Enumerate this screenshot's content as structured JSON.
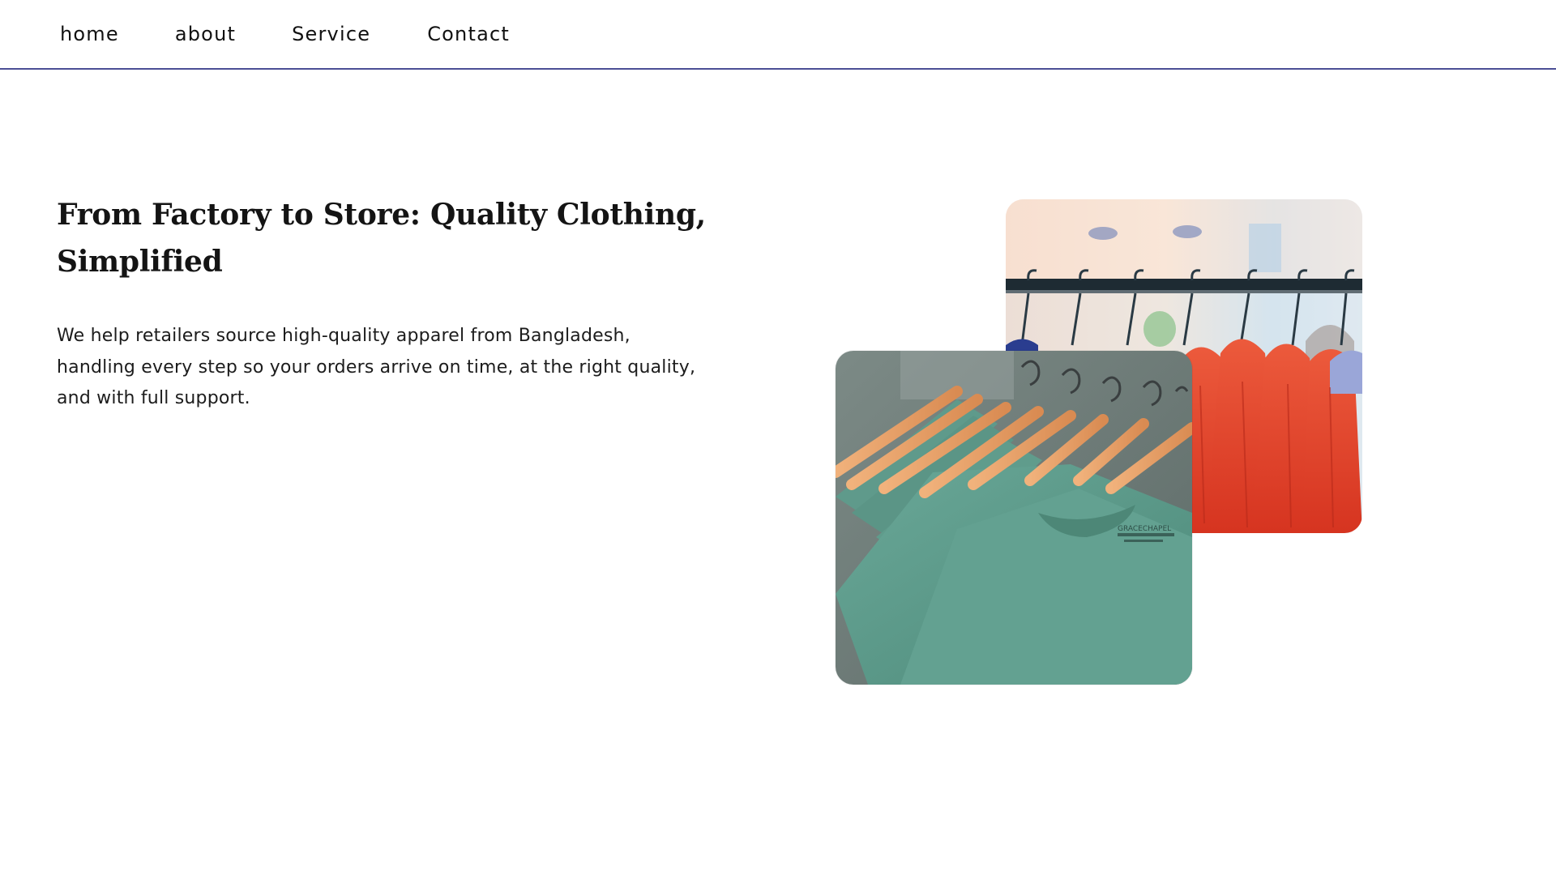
{
  "nav": {
    "items": [
      {
        "label": "home"
      },
      {
        "label": "about"
      },
      {
        "label": "Service"
      },
      {
        "label": "Contact"
      }
    ]
  },
  "hero": {
    "title_line1": "From Factory to Store: Quality Clothing,",
    "title_line2": "Simplified",
    "description_line1": "We help retailers source high-quality apparel from Bangladesh,",
    "description_line2": "handling every step so your orders arrive on time, at the right quality,",
    "description_line3": "and with full support.",
    "images": [
      {
        "subject": "red hoodies on clothing rack",
        "icon": "red-hoodies-photo"
      },
      {
        "subject": "green t-shirts on wooden hangers",
        "icon": "green-tshirts-photo"
      }
    ],
    "label_text": "GRACECHAPEL"
  },
  "colors": {
    "nav_underline": "#4b4f96",
    "text": "#111111",
    "hoodie_red": "#e4452d",
    "shirt_green": "#5b9988",
    "hanger_wood": "#e9a56f"
  }
}
